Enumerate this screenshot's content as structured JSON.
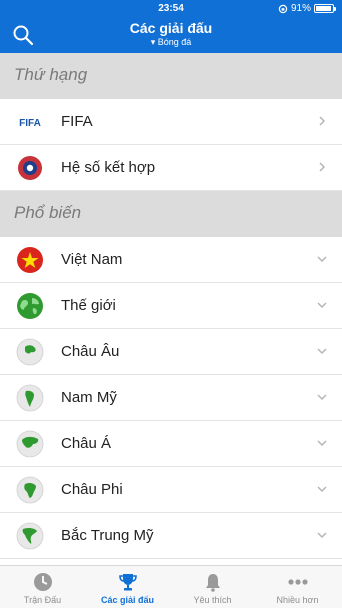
{
  "status_bar": {
    "time": "23:54",
    "battery": "91%",
    "battery_level": 0.91
  },
  "header": {
    "title": "Các giải đấu",
    "subtitle": "Bóng đá"
  },
  "sections": [
    {
      "title": "Thứ hạng",
      "items": [
        {
          "label": "FIFA",
          "icon": "fifa-logo-icon",
          "action": "chevron-right"
        },
        {
          "label": "Hệ số kết hợp",
          "icon": "uefa-logo-icon",
          "action": "chevron-right"
        }
      ]
    },
    {
      "title": "Phổ biến",
      "items": [
        {
          "label": "Việt Nam",
          "icon": "vietnam-flag-icon",
          "action": "chevron-down"
        },
        {
          "label": "Thế giới",
          "icon": "globe-icon",
          "action": "chevron-down"
        },
        {
          "label": "Châu Âu",
          "icon": "europe-globe-icon",
          "action": "chevron-down"
        },
        {
          "label": "Nam Mỹ",
          "icon": "south-america-globe-icon",
          "action": "chevron-down"
        },
        {
          "label": "Châu Á",
          "icon": "asia-globe-icon",
          "action": "chevron-down"
        },
        {
          "label": "Châu Phi",
          "icon": "africa-globe-icon",
          "action": "chevron-down"
        },
        {
          "label": "Bắc Trung Mỹ",
          "icon": "north-central-america-globe-icon",
          "action": "chevron-down"
        }
      ]
    }
  ],
  "fifa_logo_text": "FIFA",
  "tabs": [
    {
      "label": "Trận Đấu",
      "icon": "clock-icon",
      "active": false
    },
    {
      "label": "Các giải đấu",
      "icon": "trophy-icon",
      "active": true
    },
    {
      "label": "Yêu thích",
      "icon": "bell-icon",
      "active": false
    },
    {
      "label": "Nhiều hơn",
      "icon": "more-dots-icon",
      "active": false
    }
  ],
  "colors": {
    "accent": "#1170d6",
    "section_bg": "#dcdcdc",
    "globe_green": "#2f9a2f"
  }
}
